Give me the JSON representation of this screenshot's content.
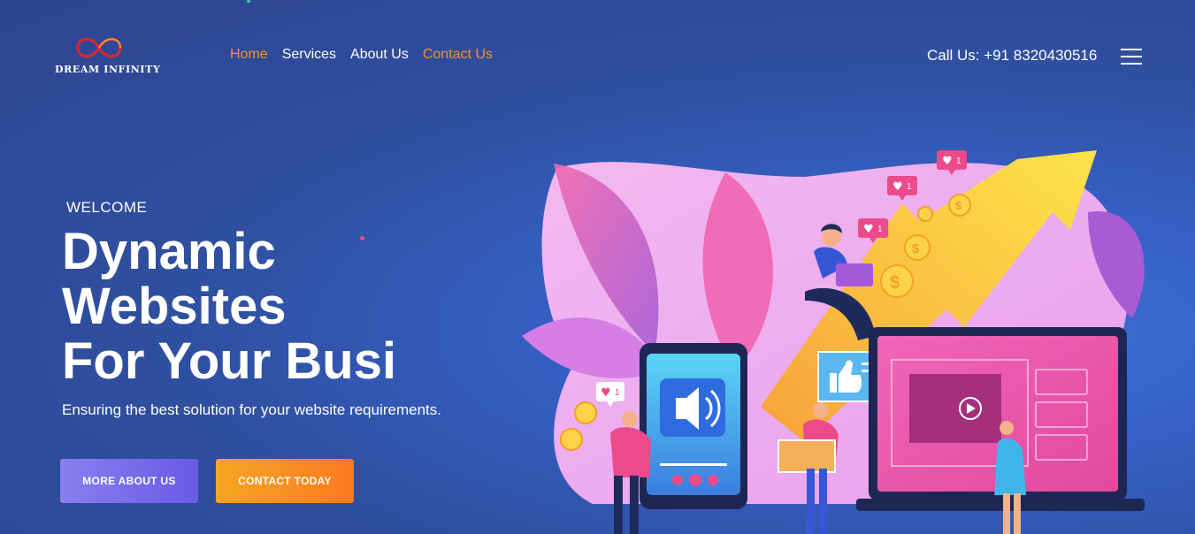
{
  "brand": {
    "name": "DREAM INFINITY"
  },
  "nav": {
    "items": [
      {
        "label": "Home"
      },
      {
        "label": "Services"
      },
      {
        "label": "About Us"
      },
      {
        "label": "Contact Us"
      }
    ]
  },
  "header": {
    "call": "Call Us: +91 8320430516"
  },
  "hero": {
    "eyebrow": "WELCOME",
    "headline": [
      "Dynamic",
      "Websites",
      "For Your Busi"
    ],
    "subtitle": "Ensuring the best solution for your website requirements.",
    "buttons": {
      "more": "MORE ABOUT US",
      "contact": "CONTACT TODAY"
    }
  },
  "illustration": {
    "badges": [
      "1",
      "1",
      "1",
      "1",
      "1"
    ]
  },
  "colors": {
    "accent": "#f5922a",
    "background": "#2f4f9f",
    "primary_button": "#7b6ef0",
    "secondary_button": "#f78c22"
  }
}
